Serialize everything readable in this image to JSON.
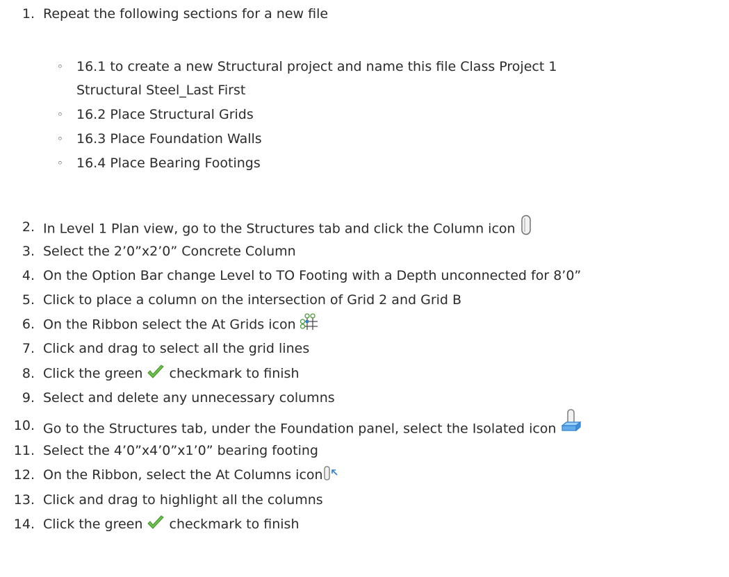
{
  "steps": [
    {
      "number": "1.",
      "text": "Repeat the following sections for a new file"
    },
    {
      "number": "2.",
      "text": "In Level 1 Plan view, go to the Structures tab and click the Column icon",
      "icon": "column-icon"
    },
    {
      "number": "3.",
      "text": "Select the 2’0”x2’0” Concrete Column"
    },
    {
      "number": "4.",
      "text": "On the Option Bar change Level to TO Footing with a Depth unconnected for 8’0”"
    },
    {
      "number": "5.",
      "text": "Click to place a column on the intersection of Grid 2 and Grid B"
    },
    {
      "number": "6.",
      "text": "On the Ribbon select the At Grids icon",
      "icon": "at-grids-icon"
    },
    {
      "number": "7.",
      "text": "Click and drag to select all the grid lines"
    },
    {
      "number": "8.",
      "text_before": "Click the green",
      "text_after": "checkmark to finish",
      "icon": "green-checkmark-icon"
    },
    {
      "number": "9.",
      "text": "Select and delete any unnecessary columns"
    },
    {
      "number": "10.",
      "text": "Go to the Structures tab, under the Foundation panel, select the Isolated icon",
      "icon": "isolated-footing-icon"
    },
    {
      "number": "11.",
      "text": "Select the 4’0”x4’0”x1’0” bearing footing"
    },
    {
      "number": "12.",
      "text": "On the Ribbon, select the At Columns icon",
      "icon": "at-columns-icon"
    },
    {
      "number": "13.",
      "text": "Click and drag to highlight all the columns"
    },
    {
      "number": "14.",
      "text_before": "Click the green",
      "text_after": "checkmark  to finish",
      "icon": "green-checkmark-icon"
    }
  ],
  "sub_items": [
    {
      "bullet": "◦",
      "text_line1": "16.1 to create a new Structural project and name this file Class Project 1",
      "text_line2": "Structural Steel_Last First"
    },
    {
      "bullet": "◦",
      "text": "16.2 Place Structural Grids"
    },
    {
      "bullet": "◦",
      "text": "16.3 Place Foundation Walls"
    },
    {
      "bullet": "◦",
      "text": "16.4 Place Bearing Footings"
    }
  ],
  "colors": {
    "text": "#2b2b2b",
    "checkmark_green": "#6cc24a",
    "icon_blue": "#2f7fd1"
  }
}
